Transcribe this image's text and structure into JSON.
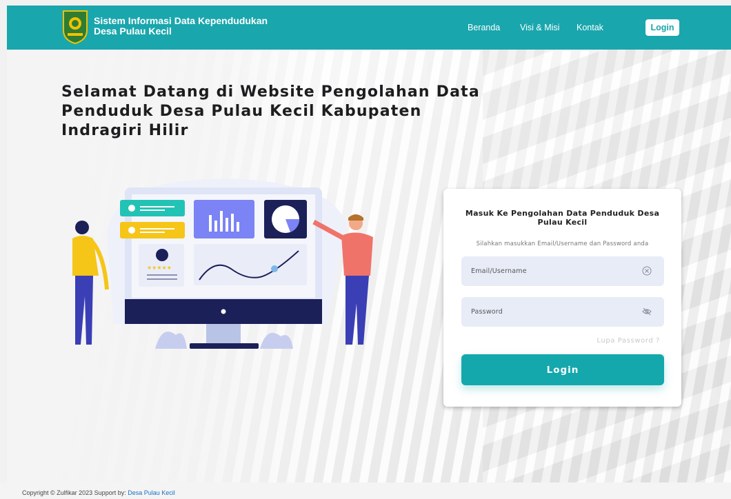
{
  "header": {
    "brand_line1": "Sistem Informasi Data Kependudukan",
    "brand_line2": "Desa Pulau Kecil",
    "nav": [
      "Beranda",
      "Visi & Misi",
      "Kontak"
    ],
    "login_label": "Login",
    "logo_icon": "regency-crest-icon",
    "bg_color": "#1aa6ad"
  },
  "hero": {
    "title": "Selamat Datang di Website Pengolahan Data Penduduk Desa Pulau Kecil Kabupaten Indragiri Hilir"
  },
  "login_card": {
    "title": "Masuk Ke Pengolahan Data Penduduk Desa Pulau Kecil",
    "subtitle": "Silahkan masukkan Email/Username dan Password anda",
    "email_placeholder": "Email/Username",
    "password_placeholder": "Password",
    "forgot_label": "Lupa Password ?",
    "submit_label": "Login",
    "accent": "#14a8ad"
  },
  "footer": {
    "prefix": "Copyright © Zulfikar 2023 Support by: ",
    "link": "Desa Pulau Kecil"
  }
}
